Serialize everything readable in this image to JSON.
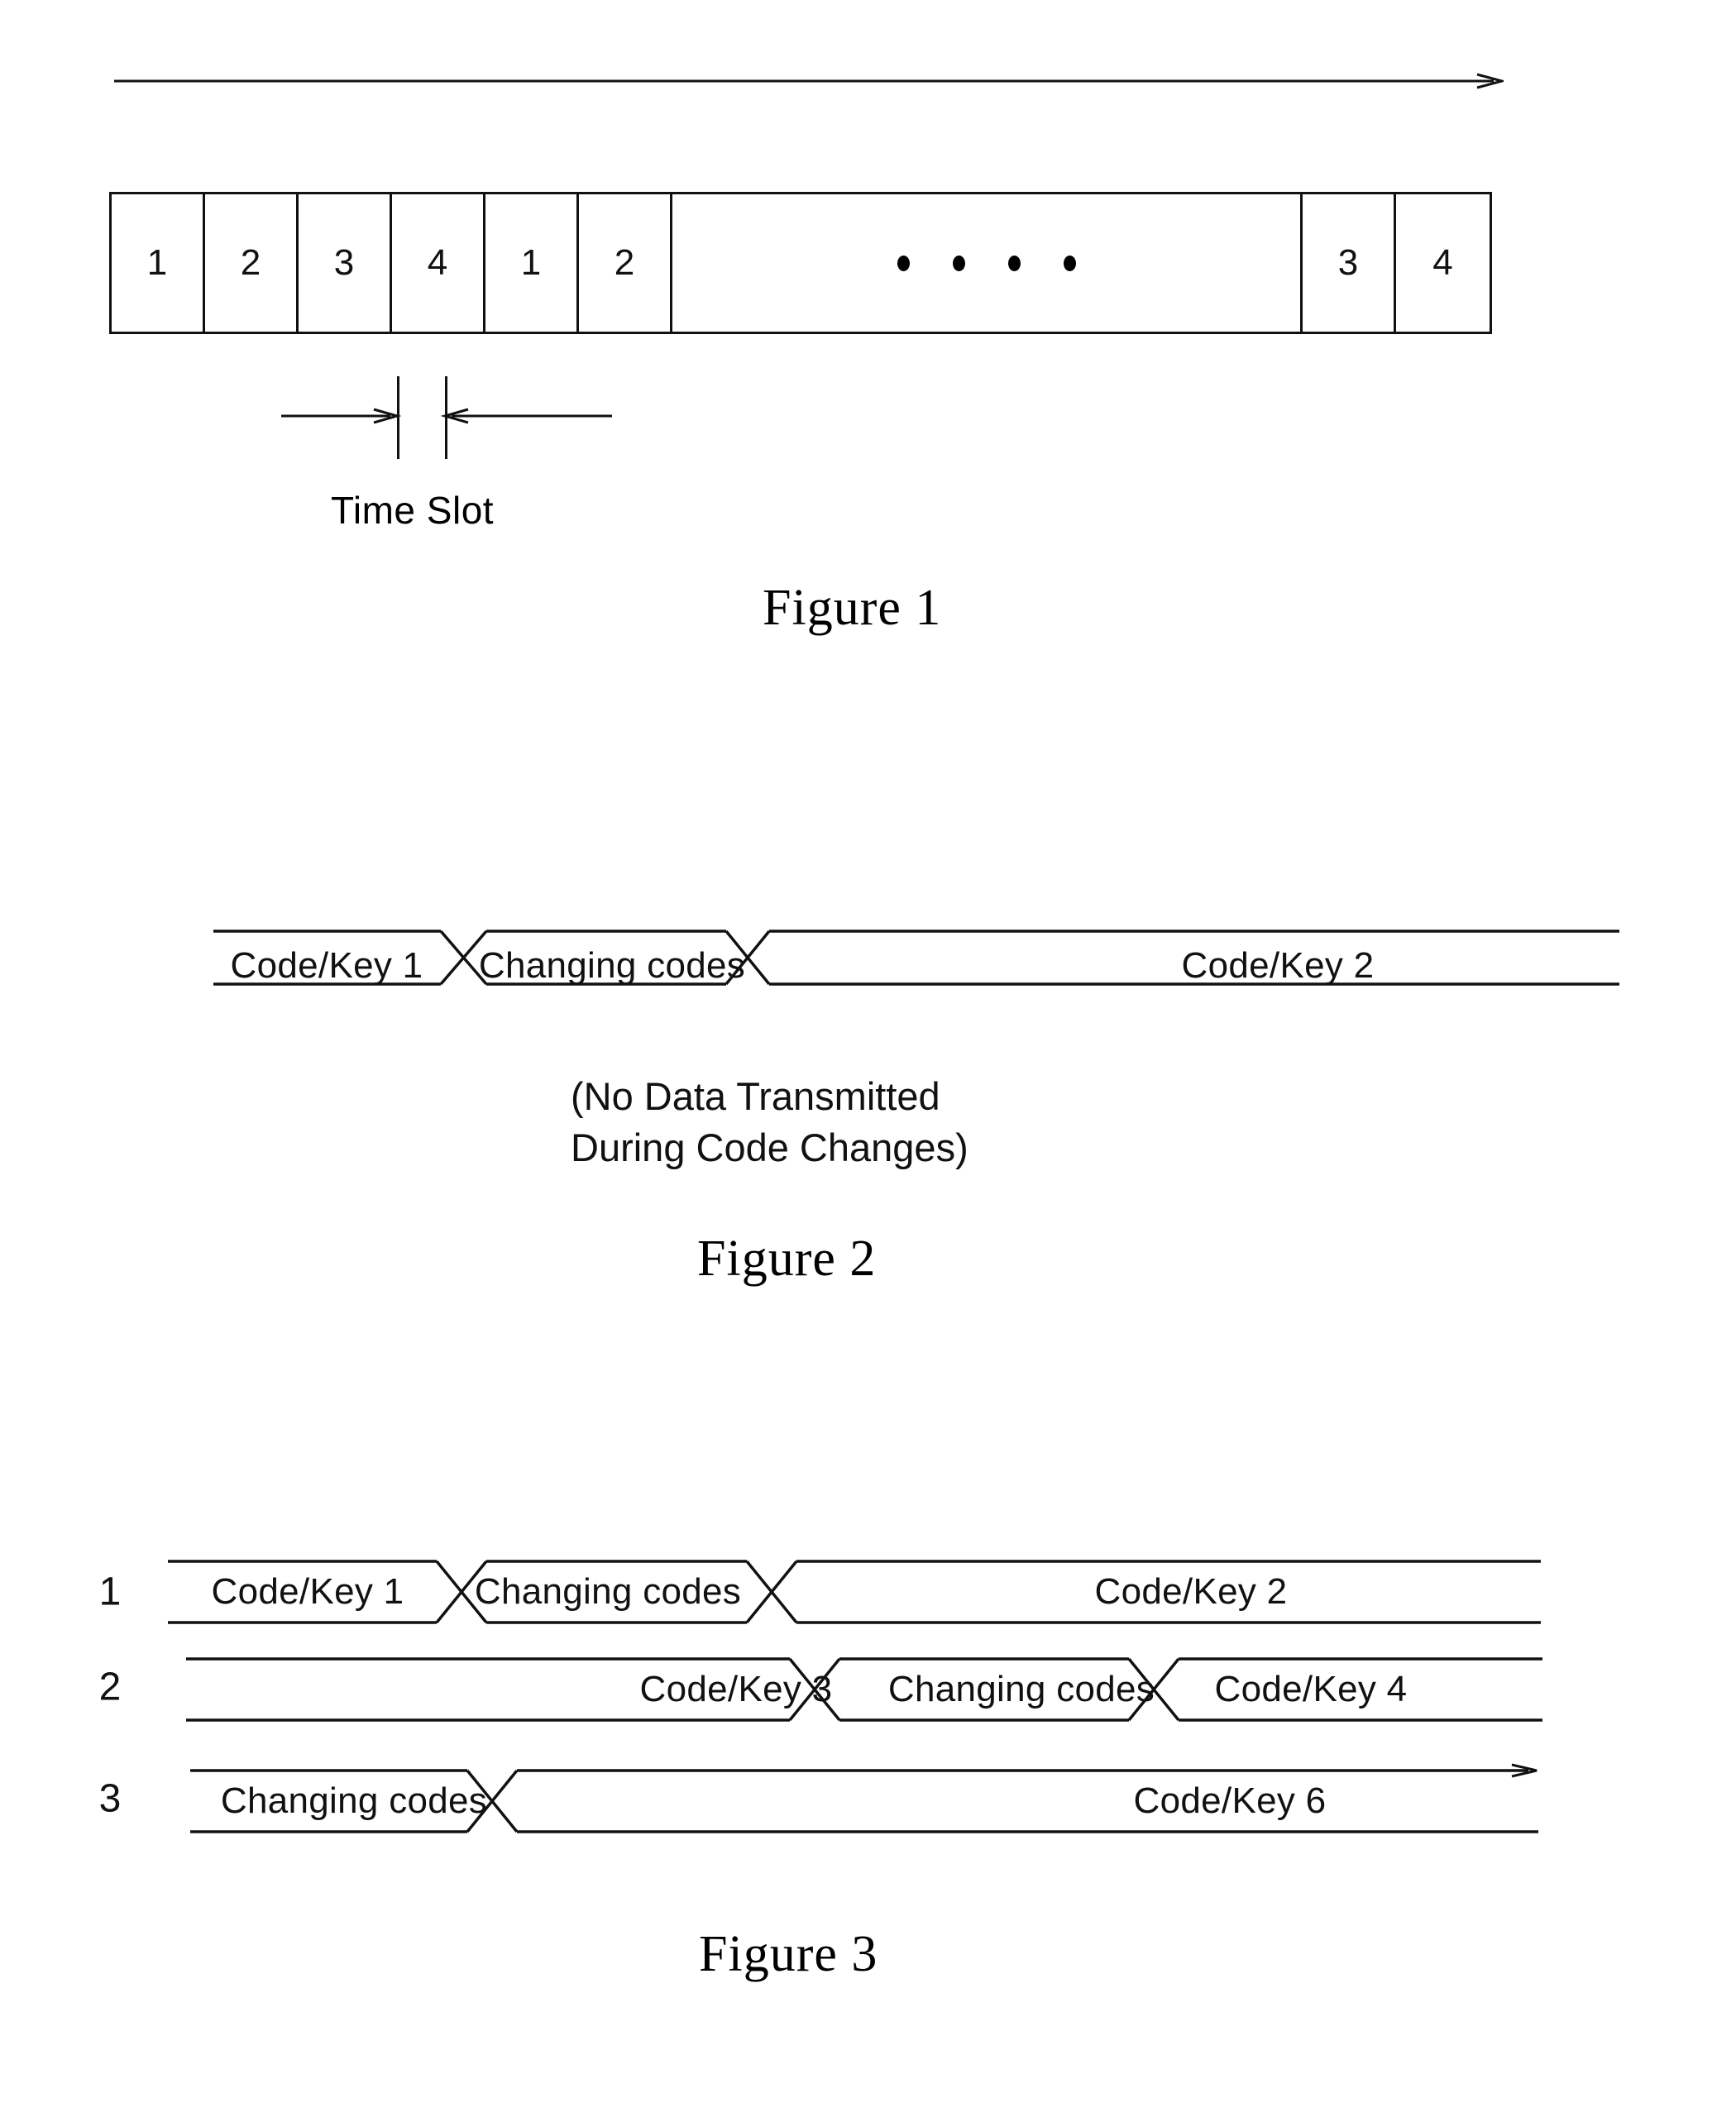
{
  "document": {
    "type": "patent-figure-sheet",
    "background": "#ffffff",
    "ink": "#111111"
  },
  "figure1": {
    "caption": "Figure 1",
    "time_axis": {
      "icon": "right-arrow-icon",
      "direction": "right"
    },
    "slots": [
      {
        "label": "1",
        "kind": "slot"
      },
      {
        "label": "2",
        "kind": "slot"
      },
      {
        "label": "3",
        "kind": "slot"
      },
      {
        "label": "4",
        "kind": "slot"
      },
      {
        "label": "1",
        "kind": "slot"
      },
      {
        "label": "2",
        "kind": "slot"
      },
      {
        "label": "",
        "kind": "ellipsis",
        "dots": 4
      },
      {
        "label": "3",
        "kind": "slot"
      },
      {
        "label": "4",
        "kind": "slot"
      }
    ],
    "measure": {
      "label": "Time Slot",
      "left_arrow_icon": "arrow-right-icon",
      "right_arrow_icon": "arrow-left-icon"
    }
  },
  "figure2": {
    "caption": "Figure 2",
    "note_lines": [
      "(No Data Transmitted",
      "During Code Changes)"
    ],
    "segments": [
      {
        "label": "Code/Key 1",
        "type": "code"
      },
      {
        "label": "Changing codes",
        "type": "changing"
      },
      {
        "label": "Code/Key 2",
        "type": "code"
      }
    ]
  },
  "figure3": {
    "caption": "Figure 3",
    "rows": [
      {
        "number": "1",
        "segments": [
          {
            "label": "Code/Key 1",
            "type": "code"
          },
          {
            "label": "Changing codes",
            "type": "changing"
          },
          {
            "label": "Code/Key 2",
            "type": "code"
          }
        ]
      },
      {
        "number": "2",
        "segments": [
          {
            "label": "Code/Key 3",
            "type": "code"
          },
          {
            "label": "Changing codes",
            "type": "changing"
          },
          {
            "label": "Code/Key 4",
            "type": "code"
          }
        ]
      },
      {
        "number": "3",
        "segments": [
          {
            "label": "Changing codes",
            "type": "changing"
          },
          {
            "label": "Code/Key 6",
            "type": "code"
          }
        ]
      }
    ]
  }
}
